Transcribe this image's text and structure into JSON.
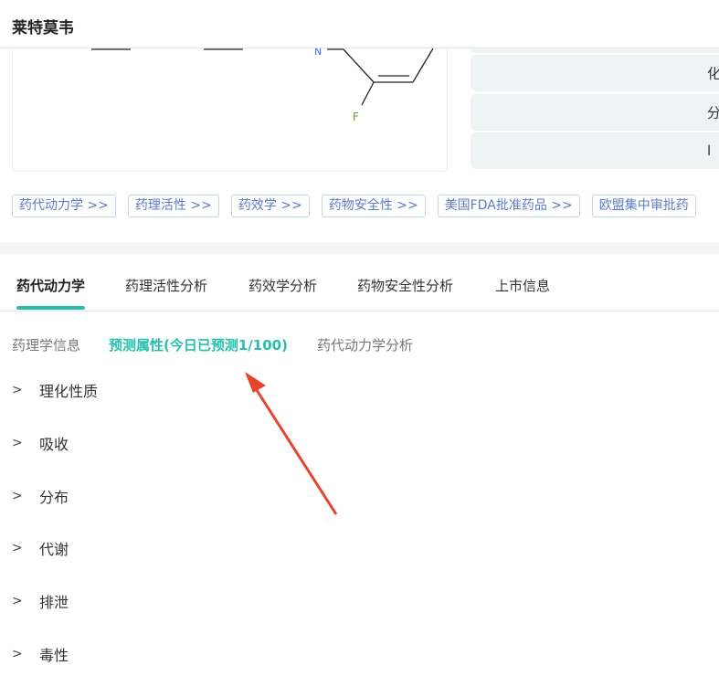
{
  "header": {
    "title": "莱特莫韦"
  },
  "structure": {
    "atoms": [
      "N",
      "F"
    ]
  },
  "properties": [
    {
      "label": "化"
    },
    {
      "label": "分"
    },
    {
      "label": "l"
    }
  ],
  "tags": [
    "药代动力学 >>",
    "药理活性 >>",
    "药效学 >>",
    "药物安全性 >>",
    "美国FDA批准药品 >>",
    "欧盟集中审批药"
  ],
  "tabs": [
    "药代动力学",
    "药理活性分析",
    "药效学分析",
    "药物安全性分析",
    "上市信息"
  ],
  "subtabs": [
    "药理学信息",
    "预测属性(今日已预测1/100)",
    "药代动力学分析"
  ],
  "sections": [
    "理化性质",
    "吸收",
    "分布",
    "代谢",
    "排泄",
    "毒性"
  ],
  "colors": {
    "accent": "#26bfad",
    "tag": "#5b7bc9",
    "arrow": "#e8432e"
  }
}
